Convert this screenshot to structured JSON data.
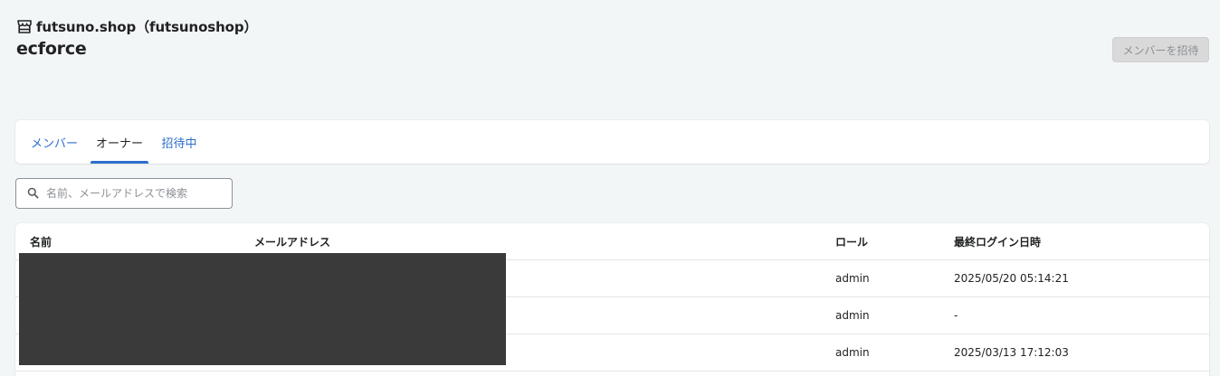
{
  "header": {
    "shop_name": "futsuno.shop（futsunoshop）",
    "org_name": "ecforce"
  },
  "invite_button": "メンバーを招待",
  "tabs": [
    {
      "label": "メンバー"
    },
    {
      "label": "オーナー"
    },
    {
      "label": "招待中"
    }
  ],
  "search": {
    "placeholder": "名前、メールアドレスで検索"
  },
  "table": {
    "columns": [
      "名前",
      "メールアドレス",
      "ロール",
      "最終ログイン日時"
    ],
    "rows": [
      {
        "name": "",
        "email": "",
        "role": "admin",
        "last_login": "2025/05/20 05:14:21"
      },
      {
        "name": "",
        "email": "",
        "role": "admin",
        "last_login": "-"
      },
      {
        "name": "",
        "email": "",
        "role": "admin",
        "last_login": "2025/03/13 17:12:03"
      }
    ]
  }
}
